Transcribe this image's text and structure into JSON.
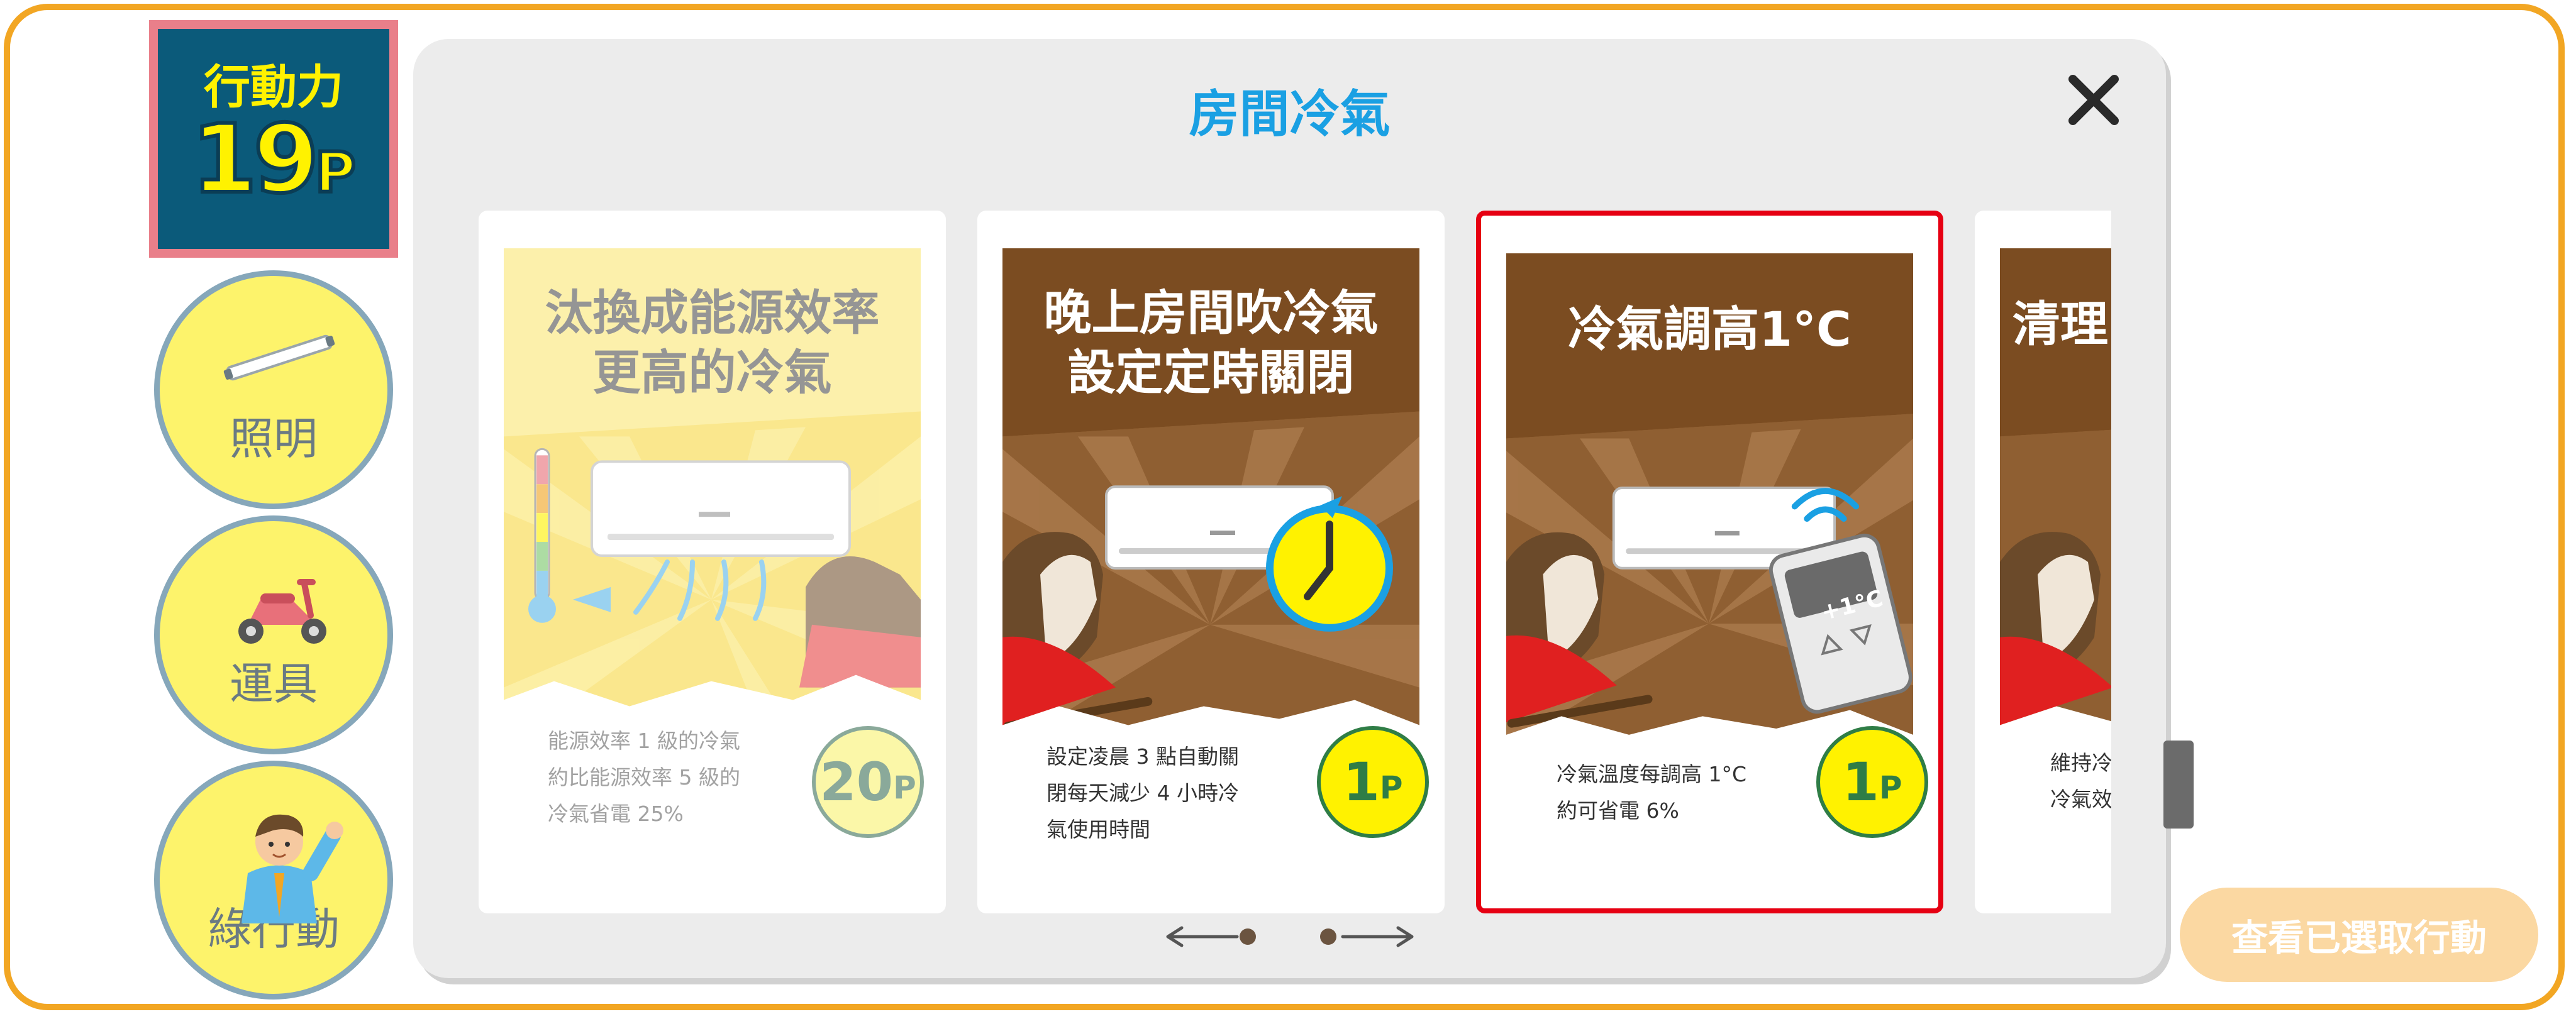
{
  "action_points": {
    "title": "行動力",
    "value": "19",
    "unit": "P"
  },
  "categories": [
    {
      "label": "照明",
      "icon": "light-tube-icon"
    },
    {
      "label": "運具",
      "icon": "scooter-icon"
    },
    {
      "label": "綠行動",
      "icon": "person-icon"
    }
  ],
  "dialog": {
    "title": "房間冷氣",
    "close_icon": "close-icon"
  },
  "cards": [
    {
      "title_line1": "汰換成能源效率",
      "title_line2": "更高的冷氣",
      "desc_line1": "能源效率 1 級的冷氣",
      "desc_line2": "約比能源效率 5 級的",
      "desc_line3": "冷氣省電 25%",
      "cost": "20",
      "cost_unit": "P",
      "state": "disabled"
    },
    {
      "title_line1": "晚上房間吹冷氣",
      "title_line2": "設定定時關閉",
      "desc_line1": "設定凌晨 3 點自動關",
      "desc_line2": "閉每天減少 4 小時冷",
      "desc_line3": "氣使用時間",
      "cost": "1",
      "cost_unit": "P",
      "state": "available"
    },
    {
      "title_line1": "冷氣調高1°C",
      "remote_label": "+1°C",
      "desc_line1": "冷氣溫度每調高 1°C",
      "desc_line2": "約可省電 6%",
      "cost": "1",
      "cost_unit": "P",
      "state": "selected"
    },
    {
      "title_partial": "清理",
      "desc_line1": "維持冷",
      "desc_line2": "冷氣效",
      "state": "available"
    }
  ],
  "view_selected_button": "查看已選取行動",
  "colors": {
    "frame": "#f2a623",
    "title_blue": "#1aa0e3",
    "selected_border": "#e60012",
    "badge_bg": "#0b5a7a",
    "badge_border": "#e97f8a",
    "category_fill": "#fdf36b",
    "category_border": "#86a7ba",
    "card_brown": "#8a5a2b",
    "card_yellow": "#fbe878"
  }
}
